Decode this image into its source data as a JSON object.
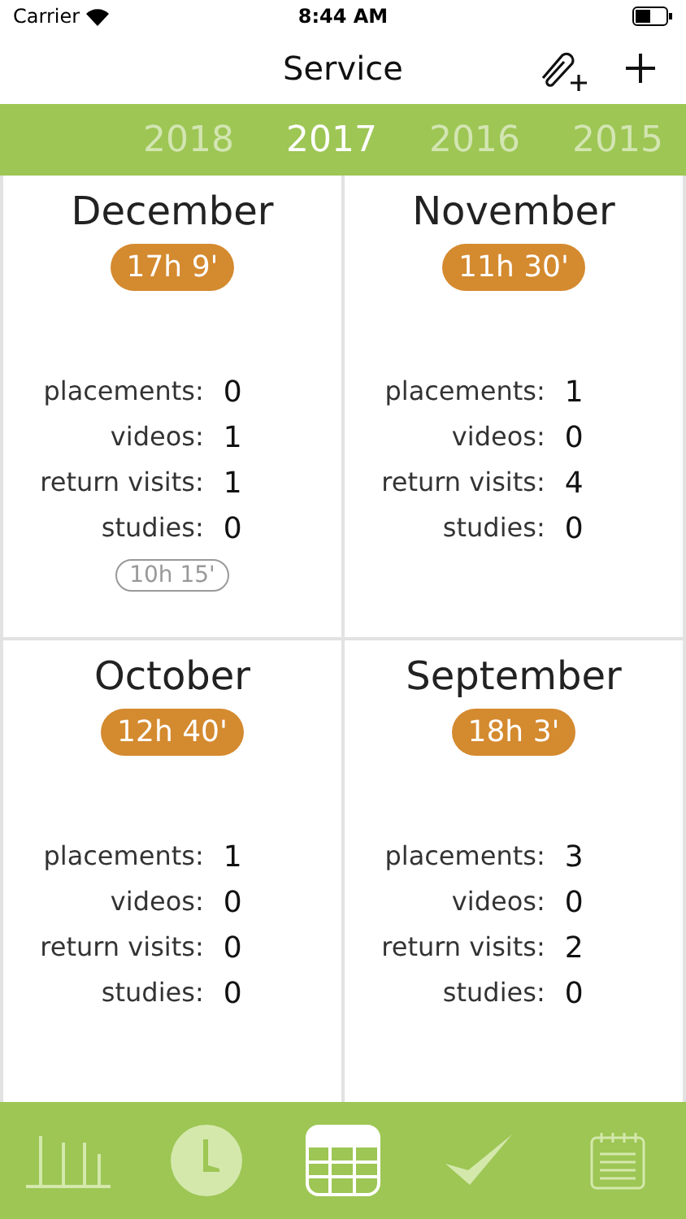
{
  "status_bar": {
    "carrier": "Carrier",
    "time": "8:44 AM"
  },
  "nav": {
    "title": "Service"
  },
  "years": [
    {
      "label": "2018",
      "selected": false
    },
    {
      "label": "2017",
      "selected": true
    },
    {
      "label": "2016",
      "selected": false
    },
    {
      "label": "2015",
      "selected": false
    }
  ],
  "months": [
    {
      "name": "December",
      "hours": "17h 9'",
      "stats": [
        {
          "label": "placements:",
          "value": "0"
        },
        {
          "label": "videos:",
          "value": "1"
        },
        {
          "label": "return visits:",
          "value": "1"
        },
        {
          "label": "studies:",
          "value": "0"
        }
      ],
      "extra_hours": "10h 15'"
    },
    {
      "name": "November",
      "hours": "11h 30'",
      "stats": [
        {
          "label": "placements:",
          "value": "1"
        },
        {
          "label": "videos:",
          "value": "0"
        },
        {
          "label": "return visits:",
          "value": "4"
        },
        {
          "label": "studies:",
          "value": "0"
        }
      ]
    },
    {
      "name": "October",
      "hours": "12h 40'",
      "stats": [
        {
          "label": "placements:",
          "value": "1"
        },
        {
          "label": "videos:",
          "value": "0"
        },
        {
          "label": "return visits:",
          "value": "0"
        },
        {
          "label": "studies:",
          "value": "0"
        }
      ]
    },
    {
      "name": "September",
      "hours": "18h 3'",
      "stats": [
        {
          "label": "placements:",
          "value": "3"
        },
        {
          "label": "videos:",
          "value": "0"
        },
        {
          "label": "return visits:",
          "value": "2"
        },
        {
          "label": "studies:",
          "value": "0"
        }
      ]
    }
  ],
  "tabs": [
    {
      "kind": "chart",
      "selected": false
    },
    {
      "kind": "clock",
      "selected": false
    },
    {
      "kind": "table",
      "selected": true
    },
    {
      "kind": "check",
      "selected": false
    },
    {
      "kind": "notepad",
      "selected": false
    }
  ]
}
